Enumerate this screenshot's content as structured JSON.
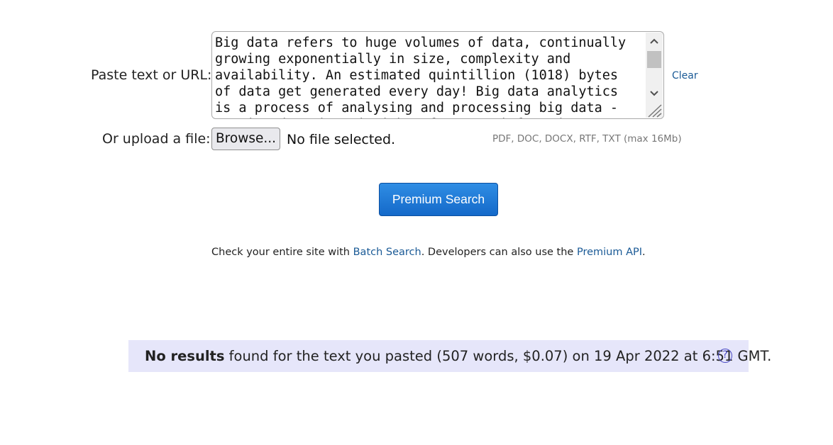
{
  "form": {
    "paste_label": "Paste text or URL:",
    "textarea_value": "Big data refers to huge volumes of data, continually growing exponentially in size, complexity and availability. An estimated quintillion (1018) bytes of data get generated every day! Big data analytics is a process of analysing and processing big data - turning data into insights for more informed",
    "clear_label": "Clear",
    "upload_label": "Or upload a file:",
    "browse_label": "Browse...",
    "file_status": "No selected.",
    "file_status_full": "No file selected.",
    "file_hint": "PDF, DOC, DOCX, RTF, TXT (max 16Mb)"
  },
  "actions": {
    "premium_search_label": "Premium Search"
  },
  "batch": {
    "prefix": "Check your entire site with ",
    "batch_link": "Batch Search",
    "middle": ". Developers can also use the ",
    "api_link": "Premium API",
    "suffix": "."
  },
  "results": {
    "bold_text": "No results",
    "rest_text": " found for the text you pasted (507 words, $0.07) on 19 Apr 2022 at 6:51 GMT.",
    "help_glyph": "?"
  },
  "colors": {
    "link": "#1a5a96",
    "button_top": "#2f8de4",
    "button_bottom": "#1469c9",
    "results_bg": "#e6e6fa",
    "help_icon": "#4b4bc4"
  },
  "icons": {
    "scroll_up": "chevron-up-icon",
    "scroll_down": "chevron-down-icon",
    "resize": "resize-grip-icon",
    "help": "help-circle-icon"
  }
}
